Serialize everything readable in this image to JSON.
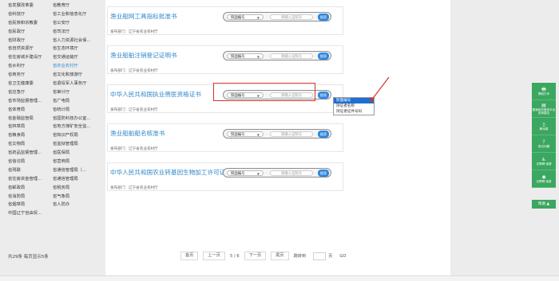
{
  "departments": [
    [
      "省发展改革委",
      "省教育厅"
    ],
    [
      "省科技厅",
      "省工业和信息化厅"
    ],
    [
      "省民族和宗教委",
      "省公安厅"
    ],
    [
      "省民政厅",
      "省司法厅"
    ],
    [
      "省财政厅",
      "省人力资源社会保..."
    ],
    [
      "省自然资源厅",
      "省生态环境厅"
    ],
    [
      "省住房城乡建设厅",
      "省交通运输厅"
    ],
    [
      "省水利厅",
      "省农业农村厅"
    ],
    [
      "省商务厅",
      "省文化和旅游厅"
    ],
    [
      "省卫生健康委",
      "省退役军人事务厅"
    ],
    [
      "省应急厅",
      "省审计厅"
    ],
    [
      "省市场监督管理...",
      "省广电局"
    ],
    [
      "省体育局",
      "省统计局"
    ],
    [
      "省金融监管局",
      "省国防科技办公室..."
    ],
    [
      "省林草局",
      "省地方煤矿安全监..."
    ],
    [
      "省粮食局",
      "省知识产权局"
    ],
    [
      "省文物局",
      "省监狱管理局"
    ],
    [
      "省药品监督管理...",
      "省医保局"
    ],
    [
      "省信访局",
      "省营商局"
    ],
    [
      "省残联",
      "省通信管理局（..."
    ],
    [
      "省住房资金管理...",
      "省通信管理局"
    ],
    [
      "省邮政局",
      "省税务局"
    ],
    [
      "省消防局",
      "省气象局"
    ],
    [
      "省烟草局",
      "省人防办"
    ],
    [
      "中国辽宁自由贸...",
      ""
    ]
  ],
  "active_department": "省农业农村厅",
  "cards": [
    {
      "title": "渔业船网工具指标批准书",
      "dept": "发布部门：辽宁省农业农村厅"
    },
    {
      "title": "渔业船舶注销登记证明书",
      "dept": "发布部门：辽宁省农业农村厅"
    },
    {
      "title": "中华人民共和国执业兽医资格证书",
      "dept": "发布部门：辽宁省农业农村厅"
    },
    {
      "title": "渔业船舶船名核准书",
      "dept": "发布部门：辽宁省农业农村厅"
    },
    {
      "title": "中华人民共和国农业转基因生物加工许可证",
      "dept": "发布部门：辽宁省农业农村厅"
    }
  ],
  "search": {
    "select_value": "照面编号",
    "input_placeholder": "请输入证照号",
    "button_label": "搜索"
  },
  "dropdown_options": [
    "照面编号",
    "持证者名称",
    "持证者证件号码"
  ],
  "pager": {
    "info": "共29条 每页显示5条",
    "first": "首页",
    "prev": "上一页",
    "page": "5 / 6",
    "next": "下一页",
    "last": "尾页",
    "jump": "跳转到",
    "unit": "页",
    "go": "GO"
  },
  "toolbar": [
    {
      "icon": "printer-icon",
      "label": "帮助打印"
    },
    {
      "icon": "document-icon",
      "label": "国家政务服务平台咨询建议"
    },
    {
      "icon": "mobile-icon",
      "label": "移动端"
    },
    {
      "icon": "question-icon",
      "label": "常见问题"
    },
    {
      "icon": "accessibility-icon",
      "label": "无障碍·读屏"
    },
    {
      "icon": "eye-icon",
      "label": "无障碍·读音"
    }
  ],
  "back_label": "帮助",
  "colors": {
    "accent": "#2f86de",
    "toolbar": "#3ba760",
    "highlight": "#d9302a",
    "title": "#2e86c9"
  }
}
